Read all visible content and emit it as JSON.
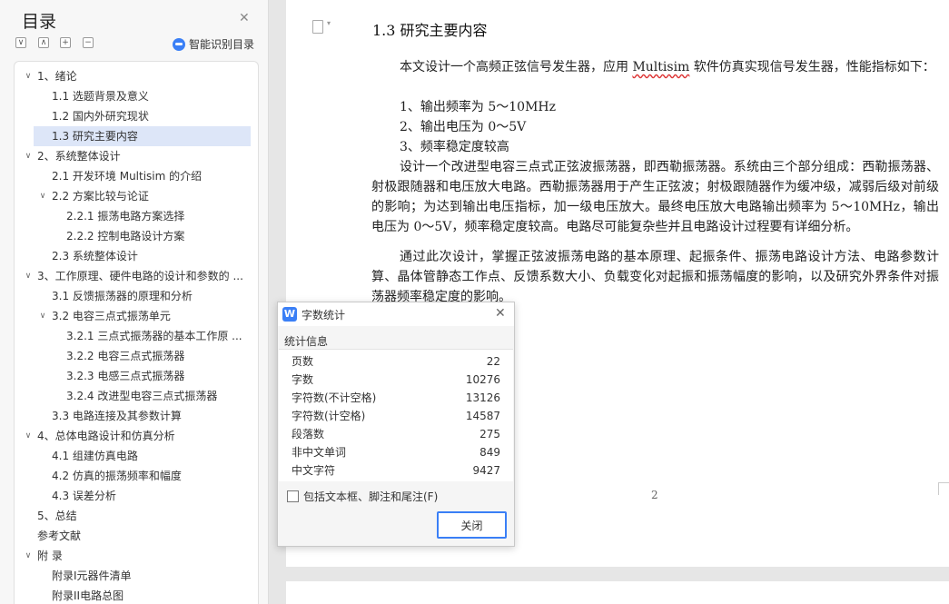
{
  "toc": {
    "title": "目录",
    "smart_label": "智能识别目录",
    "items": [
      {
        "label": "1、绪论",
        "caret": "∨"
      },
      {
        "label": "1.1 选题背景及意义",
        "caret": ""
      },
      {
        "label": "1.2 国内外研究现状",
        "caret": ""
      },
      {
        "label": "1.3 研究主要内容",
        "caret": ""
      },
      {
        "label": "2、系统整体设计",
        "caret": "∨"
      },
      {
        "label": "2.1 开发环境 Multisim 的介绍",
        "caret": ""
      },
      {
        "label": "2.2 方案比较与论证",
        "caret": "∨"
      },
      {
        "label": "2.2.1 振荡电路方案选择",
        "caret": ""
      },
      {
        "label": "2.2.2 控制电路设计方案",
        "caret": ""
      },
      {
        "label": "2.3 系统整体设计",
        "caret": ""
      },
      {
        "label": "3、工作原理、硬件电路的设计和参数的 ...",
        "caret": "∨"
      },
      {
        "label": "3.1 反馈振荡器的原理和分析",
        "caret": ""
      },
      {
        "label": "3.2 电容三点式振荡单元",
        "caret": "∨"
      },
      {
        "label": "3.2.1 三点式振荡器的基本工作原 ...",
        "caret": ""
      },
      {
        "label": "3.2.2 电容三点式振荡器",
        "caret": ""
      },
      {
        "label": "3.2.3 电感三点式振荡器",
        "caret": ""
      },
      {
        "label": "3.2.4 改进型电容三点式振荡器",
        "caret": ""
      },
      {
        "label": "3.3 电路连接及其参数计算",
        "caret": ""
      },
      {
        "label": "4、总体电路设计和仿真分析",
        "caret": "∨"
      },
      {
        "label": "4.1 组建仿真电路",
        "caret": ""
      },
      {
        "label": "4.2 仿真的振荡频率和幅度",
        "caret": ""
      },
      {
        "label": "4.3 误差分析",
        "caret": ""
      },
      {
        "label": "5、总结",
        "caret": ""
      },
      {
        "label": "参考文献",
        "caret": ""
      },
      {
        "label": "附  录",
        "caret": "∨"
      },
      {
        "label": "附录I元器件清单",
        "caret": ""
      },
      {
        "label": "附录II电路总图",
        "caret": ""
      }
    ]
  },
  "document": {
    "heading": "1.3 研究主要内容",
    "para1_before": "本文设计一个高频正弦信号发生器，应用 ",
    "para1_word": "Multisim",
    "para1_after": " 软件仿真实现信号发生器，性能指标如下：",
    "list": [
      "1、输出频率为 5～10MHz",
      "2、输出电压为 0～5V",
      "3、频率稳定度较高"
    ],
    "para2": "设计一个改进型电容三点式正弦波振荡器，即西勒振荡器。系统由三个部分组成：西勒振荡器、射极跟随器和电压放大电路。西勒振荡器用于产生正弦波；射极跟随器作为缓冲级，减弱后级对前级的影响；为达到输出电压指标，加一级电压放大。最终电压放大电路输出频率为 5～10MHz，输出电压为 0～5V，频率稳定度较高。电路尽可能复杂些并且电路设计过程要有详细分析。",
    "para3": "通过此次设计，掌握正弦波振荡电路的基本原理、起振条件、振荡电路设计方法、电路参数计算、晶体管静态工作点、反馈系数大小、负载变化对起振和振荡幅度的影响，以及研究外界条件对振荡器频率稳定度的影响。",
    "page_number": "2"
  },
  "dialog": {
    "icon_letter": "W",
    "title": "字数统计",
    "section": "统计信息",
    "stats": [
      {
        "label": "页数",
        "value": "22"
      },
      {
        "label": "字数",
        "value": "10276"
      },
      {
        "label": "字符数(不计空格)",
        "value": "13126"
      },
      {
        "label": "字符数(计空格)",
        "value": "14587"
      },
      {
        "label": "段落数",
        "value": "275"
      },
      {
        "label": "非中文单词",
        "value": "849"
      },
      {
        "label": "中文字符",
        "value": "9427"
      }
    ],
    "checkbox_label": "包括文本框、脚注和尾注(F)",
    "close_button": "关闭"
  }
}
